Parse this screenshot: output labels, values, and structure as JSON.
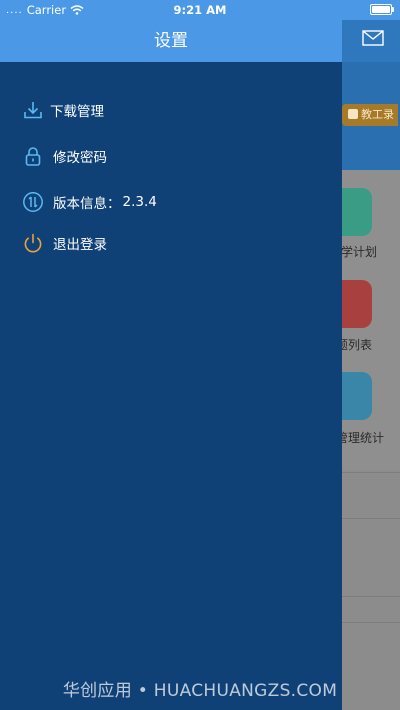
{
  "status_bar": {
    "signal": "....",
    "carrier": "Carrier",
    "time": "9:21 AM"
  },
  "drawer": {
    "title": "设置",
    "menu": [
      {
        "label": "下载管理",
        "icon": "download-icon"
      },
      {
        "label": "修改密码",
        "icon": "lock-icon"
      },
      {
        "label": "版本信息：",
        "value": "2.3.4",
        "icon": "version-icon"
      },
      {
        "label": "退出登录",
        "icon": "power-icon"
      }
    ]
  },
  "background_app": {
    "badge_label": "教工录",
    "tiles": [
      {
        "label": "学计划",
        "color": "#3a9c85"
      },
      {
        "label": "题列表",
        "color": "#a8403f"
      },
      {
        "label": "管理统计",
        "color": "#3a86a8"
      }
    ]
  },
  "watermark": "华创应用 • HUACHUANGZS.COM",
  "colors": {
    "drawer_bg": "#0f4177",
    "header_bg": "#4a98e6",
    "download_icon": "#5bb8f0",
    "lock_icon": "#5bb8f0",
    "version_icon": "#5bb8f0",
    "power_icon": "#e8a33a"
  }
}
